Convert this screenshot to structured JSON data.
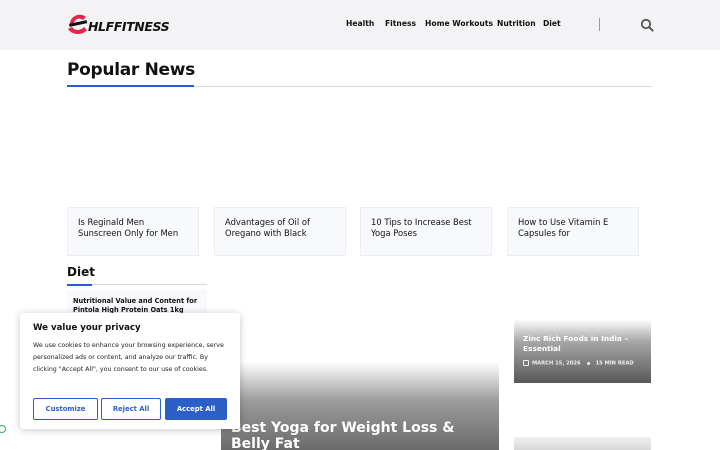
{
  "header": {
    "logo_text": "HLFFITNESS",
    "nav": [
      "Health",
      "Fitness",
      "Home Workouts",
      "Nutrition",
      "Diet"
    ]
  },
  "popular": {
    "title": "Popular News",
    "cards": [
      "Is Reginald Men Sunscreen Only for Men",
      "Advantages of Oil of Oregano with Black",
      "10 Tips to Increase Best Yoga Poses",
      "How to Use Vitamin E Capsules for"
    ]
  },
  "diet": {
    "title": "Diet",
    "items": [
      "Nutritional Value and Content for Pintola High Protein Oats 1kg"
    ]
  },
  "features": {
    "large_title": "Best Yoga for Weight Loss & Belly Fat",
    "right_title": "Zinc Rich Foods in India – Essential",
    "right_date": "MARCH 15, 2026",
    "right_read": "15 MIN READ"
  },
  "cookie": {
    "title": "We value your privacy",
    "text": "We use cookies to enhance your browsing experience, serve personalized ads or content, and analyze our traffic. By clicking \"Accept All\", you consent to our use of cookies.",
    "customize": "Customize",
    "reject": "Reject All",
    "accept": "Accept All"
  },
  "colors": {
    "accent": "#2a5bd7",
    "logo_red": "#e8234a",
    "badge_green": "#1db46a"
  },
  "icons": [
    "logo-mark-icon",
    "search-icon",
    "calendar-icon"
  ]
}
